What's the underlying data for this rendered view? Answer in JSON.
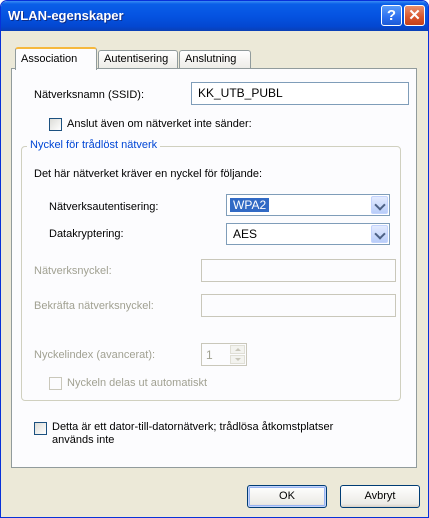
{
  "window": {
    "title": "WLAN-egenskaper",
    "help_label": "?",
    "close_label": "✕"
  },
  "tabs": [
    {
      "label": "Association",
      "active": true
    },
    {
      "label": "Autentisering",
      "active": false
    },
    {
      "label": "Anslutning",
      "active": false
    }
  ],
  "ssid": {
    "label": "Nätverksnamn (SSID):",
    "value": "KK_UTB_PUBL"
  },
  "broadcast_checkbox": {
    "label": "Anslut även om nätverket inte sänder:",
    "checked": false
  },
  "wireless_key": {
    "legend": "Nyckel för trådlöst nätverk",
    "description": "Det här nätverket kräver en nyckel för följande:",
    "auth_label": "Nätverksautentisering:",
    "auth_value": "WPA2",
    "encryption_label": "Datakryptering:",
    "encryption_value": "AES",
    "network_key_label": "Nätverksnyckel:",
    "network_key_value": "",
    "confirm_key_label": "Bekräfta nätverksnyckel:",
    "confirm_key_value": "",
    "key_index_label": "Nyckelindex (avancerat):",
    "key_index_value": "1",
    "auto_key_label": "Nyckeln delas ut automatiskt",
    "auto_key_checked": false
  },
  "adhoc_checkbox": {
    "label_line1": "Detta är ett dator-till-datornätverk; trådlösa åtkomstplatser",
    "label_line2": "används inte",
    "checked": false
  },
  "buttons": {
    "ok": "OK",
    "cancel": "Avbryt"
  },
  "colors": {
    "titlebar": "#0553e1",
    "dialog_bg": "#ece9d8",
    "legend_text": "#0046d5",
    "selection": "#316ac5"
  }
}
